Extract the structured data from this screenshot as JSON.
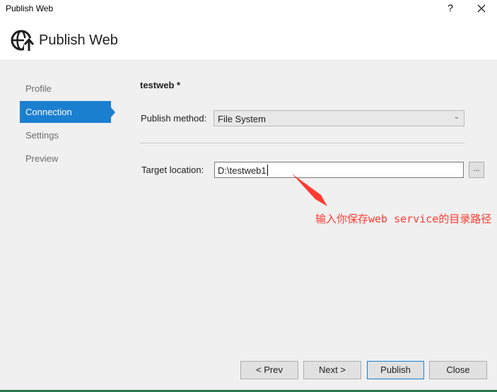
{
  "window": {
    "title": "Publish Web",
    "help_label": "?",
    "close_icon": "close-icon"
  },
  "header": {
    "title": "Publish Web",
    "icon": "globe-publish-icon"
  },
  "sidebar": {
    "items": [
      {
        "label": "Profile",
        "active": false
      },
      {
        "label": "Connection",
        "active": true
      },
      {
        "label": "Settings",
        "active": false
      },
      {
        "label": "Preview",
        "active": false
      }
    ]
  },
  "main": {
    "profile_name": "testweb *",
    "publish_method_label": "Publish method:",
    "publish_method_value": "File System",
    "target_location_label": "Target location:",
    "target_location_value": "D:\\testweb1",
    "browse_label": "..."
  },
  "annotation": {
    "text": "输入你保存web service的目录路径",
    "color": "#ff3b30"
  },
  "footer": {
    "prev_label": "< Prev",
    "next_label": "Next >",
    "publish_label": "Publish",
    "close_label": "Close"
  },
  "colors": {
    "accent": "#1b7fd0",
    "panel": "#f0f0f0"
  }
}
